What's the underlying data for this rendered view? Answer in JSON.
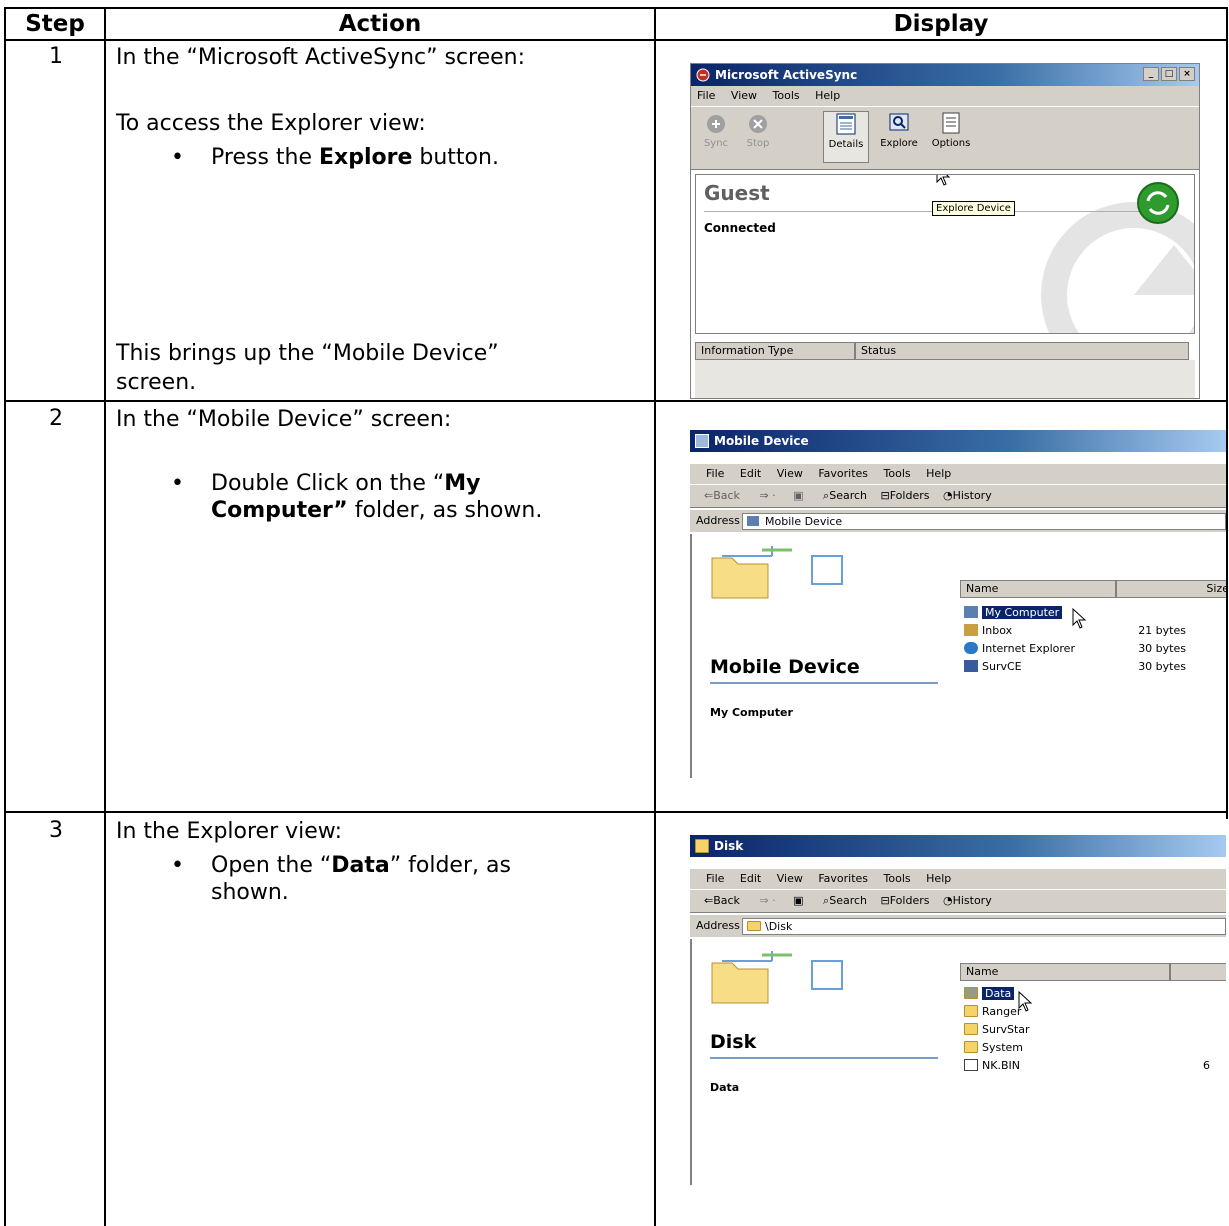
{
  "table": {
    "headers": {
      "step": "Step",
      "action": "Action",
      "display": "Display"
    }
  },
  "steps": [
    {
      "number": "1",
      "intro": "In the “Microsoft ActiveSync” screen:",
      "line2": "To access the Explorer view:",
      "bullet_pre": "Press the ",
      "bullet_bold": "Explore",
      "bullet_post": " button.",
      "outro_1": "This brings up the “Mobile Device”",
      "outro_2": "screen."
    },
    {
      "number": "2",
      "intro": "In the “Mobile Device” screen:",
      "bullet_pre": "Double Click on the “",
      "bullet_bold_1": "My",
      "bullet_bold_2": "Computer”",
      "bullet_post": " folder, as shown."
    },
    {
      "number": "3",
      "intro": "In the Explorer view:",
      "bullet_pre": "Open the “",
      "bullet_bold": "Data",
      "bullet_post": "” folder, as",
      "bullet_line2": "shown."
    }
  ],
  "shot1": {
    "title": "Microsoft ActiveSync",
    "menu": [
      "File",
      "View",
      "Tools",
      "Help"
    ],
    "toolbar": [
      "Sync",
      "Stop",
      "Details",
      "Explore",
      "Options"
    ],
    "profile": "Guest",
    "state": "Connected",
    "tooltip": "Explore Device",
    "columns": [
      "Information Type",
      "Status"
    ]
  },
  "shot2": {
    "title": "Mobile Device",
    "menu": [
      "File",
      "Edit",
      "View",
      "Favorites",
      "Tools",
      "Help"
    ],
    "toolbar": {
      "back": "⇐Back",
      "search": "Search",
      "folders": "Folders",
      "history": "History"
    },
    "address_label": "Address",
    "address_value": "Mobile Device",
    "heading": "Mobile Device",
    "sub": "My Computer",
    "columns": [
      "Name",
      "Size"
    ],
    "rows": [
      {
        "name": "My Computer",
        "size": ""
      },
      {
        "name": "Inbox",
        "size": "21 bytes"
      },
      {
        "name": "Internet Explorer",
        "size": "30 bytes"
      },
      {
        "name": "SurvCE",
        "size": "30 bytes"
      }
    ]
  },
  "shot3": {
    "title": "Disk",
    "menu": [
      "File",
      "Edit",
      "View",
      "Favorites",
      "Tools",
      "Help"
    ],
    "toolbar": {
      "back": "⇐Back",
      "search": "Search",
      "folders": "Folders",
      "history": "History"
    },
    "address_label": "Address",
    "address_value": "\\Disk",
    "heading": "Disk",
    "sub": "Data",
    "columns": [
      "Name"
    ],
    "rows": [
      {
        "name": "Data",
        "size": ""
      },
      {
        "name": "Ranger",
        "size": ""
      },
      {
        "name": "SurvStar",
        "size": ""
      },
      {
        "name": "System",
        "size": ""
      },
      {
        "name": "NK.BIN",
        "size": "6"
      }
    ]
  }
}
